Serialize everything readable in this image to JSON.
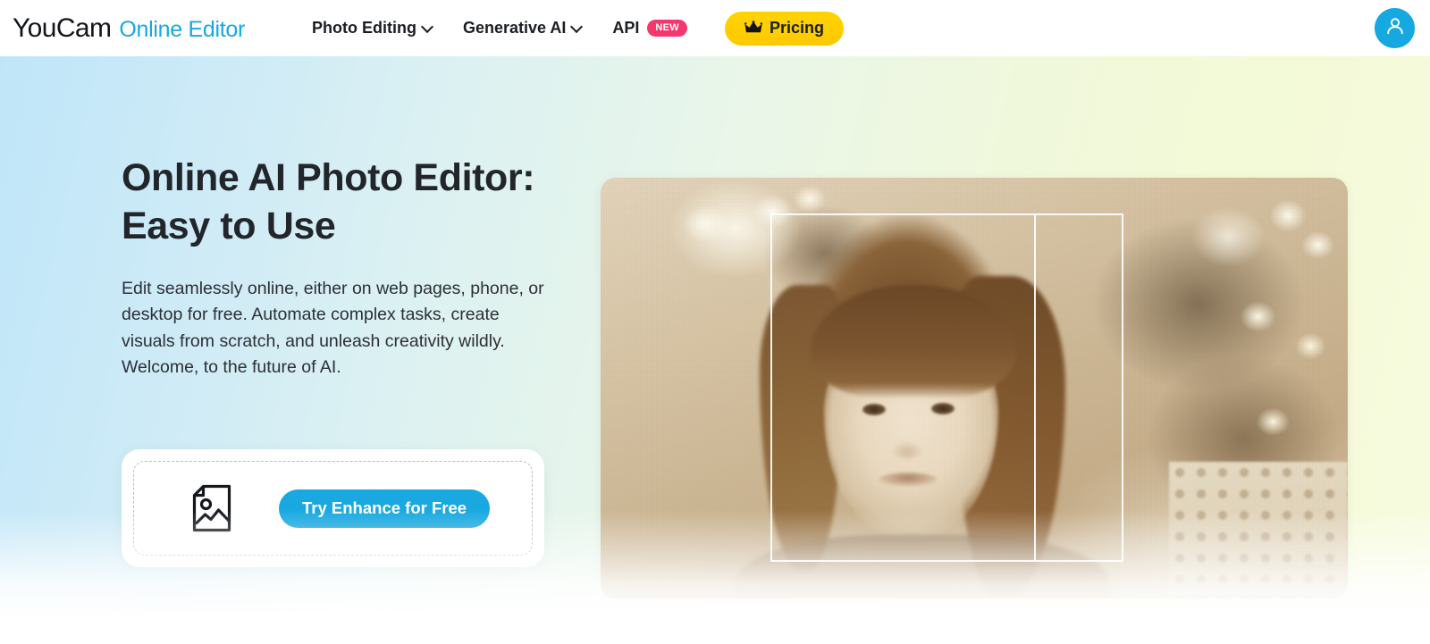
{
  "header": {
    "logo": {
      "main": "YouCam",
      "sub": "Online Editor"
    },
    "nav": [
      {
        "label": "Photo Editing",
        "has_chevron": true,
        "badge": null,
        "icon": "chevron-down-icon"
      },
      {
        "label": "Generative AI",
        "has_chevron": true,
        "badge": null,
        "icon": "chevron-down-icon"
      },
      {
        "label": "API",
        "has_chevron": false,
        "badge": "NEW",
        "icon": null
      }
    ],
    "pricing": {
      "label": "Pricing",
      "icon": "crown-icon"
    },
    "account": {
      "icon": "user-avatar-icon"
    }
  },
  "hero": {
    "headline_line1": "Online AI Photo Editor:",
    "headline_line2": "Easy to Use",
    "subtext": "Edit seamlessly online, either on web pages, phone, or desktop for free. Automate complex tasks, create visuals from scratch, and unleash creativity wildly. Welcome, to the future of AI.",
    "upload": {
      "icon": "image-file-icon",
      "button_label": "Try Enhance for Free"
    },
    "preview": {
      "alt": "sepia portrait of a young girl with bangs, blurred holiday lights background",
      "overlay": "face-selection-frame-with-before-after-divider"
    }
  },
  "colors": {
    "brand_cyan": "#16a9e1",
    "pricing_yellow": "#ffd400",
    "badge_pink": "#f4376d",
    "text_dark": "#1a1d21"
  }
}
